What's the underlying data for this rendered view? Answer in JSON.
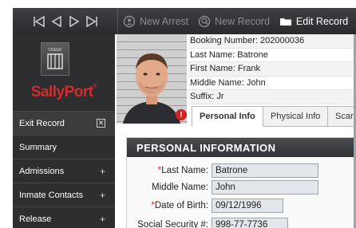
{
  "toolbar": {
    "nav_icons": [
      "first-record-icon",
      "previous-record-icon",
      "next-record-icon",
      "last-record-icon"
    ],
    "new_arrest": "New Arrest",
    "new_record": "New Record",
    "edit_record": "Edit Record"
  },
  "sidebar": {
    "logo_text": "SallyPort",
    "logo_reg": "®",
    "logo_badge_text": "CREEK",
    "exit_label": "Exit Record",
    "exit_box": "✕",
    "items": [
      {
        "label": "Summary",
        "plus": ""
      },
      {
        "label": "Admissions",
        "plus": "+"
      },
      {
        "label": "Inmate Contacts",
        "plus": "+"
      },
      {
        "label": "Release",
        "plus": "+"
      }
    ]
  },
  "booking": {
    "booking_number": "Booking Number: 202000036",
    "last_name": "Last Name: Batrone",
    "first_name": "First Name: Frank",
    "middle_name": "Middle Name: John",
    "suffix": "Suffix: Jr"
  },
  "alert": "!",
  "tabs": [
    "Personal Info",
    "Physical Info",
    "Scar"
  ],
  "panel": {
    "title": "PERSONAL INFORMATION",
    "fields": {
      "last_name": {
        "required": "*",
        "label": "Last Name:",
        "value": "Batrone"
      },
      "middle_name": {
        "required": "",
        "label": "Middle Name:",
        "value": "John"
      },
      "dob": {
        "required": "*",
        "label": "Date of Birth:",
        "value": "09/12/1996"
      },
      "ssn": {
        "required": "",
        "label": "Social Security #:",
        "value": "998-77-7736"
      }
    }
  },
  "colors": {
    "brand_red": "#d62b2b",
    "required_red": "#d31f1f",
    "toolbar_bg": "#2a2b2d",
    "input_bg": "#e3e6ea"
  }
}
